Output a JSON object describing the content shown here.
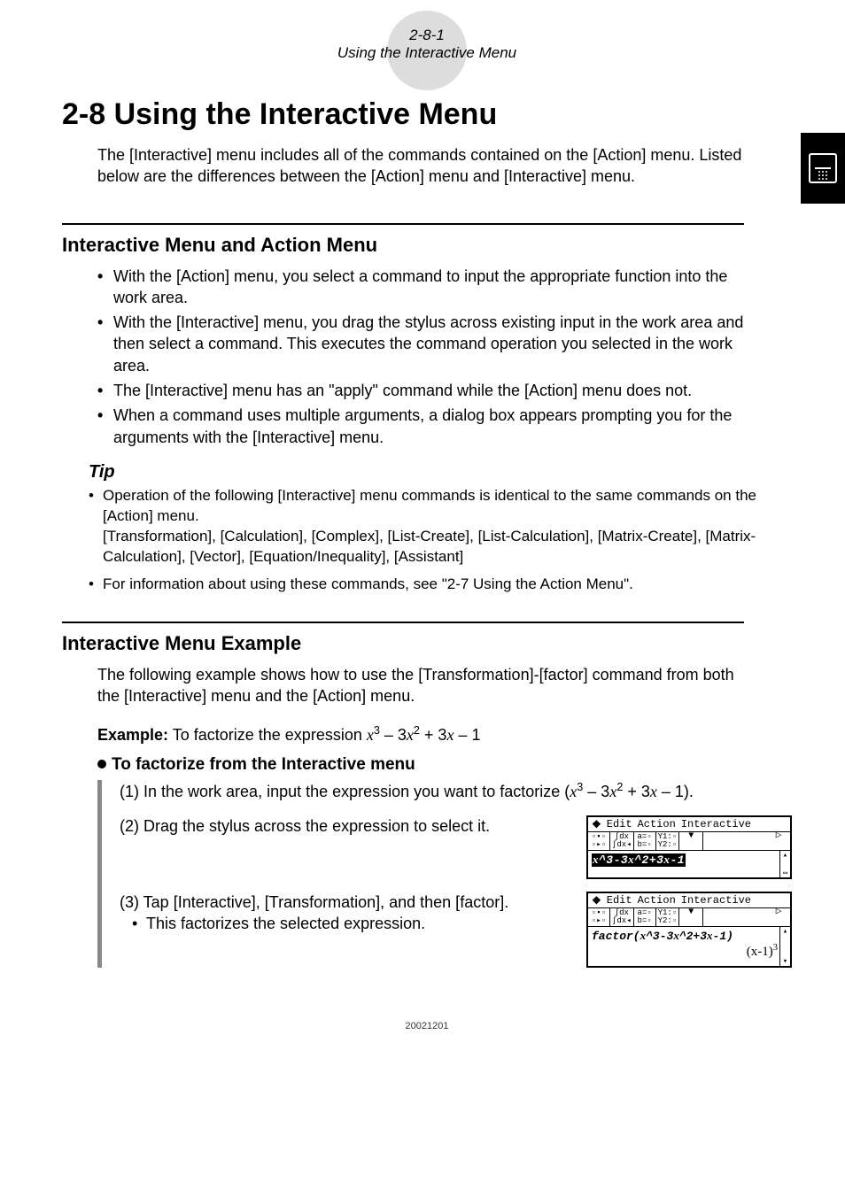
{
  "header": {
    "page_ref": "2-8-1",
    "section_title": "Using the Interactive Menu"
  },
  "title": "2-8 Using the Interactive Menu",
  "intro": "The [Interactive] menu includes all of the commands contained on the [Action] menu. Listed below are the differences between the [Action] menu and [Interactive] menu.",
  "section1": {
    "heading": "Interactive Menu and Action Menu",
    "bullets": [
      "With the [Action] menu, you select a command to input the appropriate function into the work area.",
      "With the [Interactive] menu, you drag the stylus across existing input in the work area and then select a command. This executes the command operation you selected in the work area.",
      "The [Interactive] menu has an \"apply\" command while the [Action] menu does not.",
      "When a command uses multiple arguments, a dialog box appears prompting you for the arguments with the [Interactive] menu."
    ],
    "tip_label": "Tip",
    "tips": [
      {
        "main": "Operation of the following [Interactive] menu commands is identical to the same commands on the [Action] menu.",
        "sub": "[Transformation], [Calculation], [Complex], [List-Create], [List-Calculation], [Matrix-Create], [Matrix-Calculation], [Vector], [Equation/Inequality], [Assistant]"
      },
      {
        "main": "For information about using these commands, see \"2-7 Using the Action Menu\"."
      }
    ]
  },
  "section2": {
    "heading": "Interactive Menu Example",
    "intro": "The following example shows how to use the [Transformation]-[factor] command from both the [Interactive] menu and the [Action] menu.",
    "example_label": "Example:",
    "example_text": "To factorize the expression ",
    "subhead": "To factorize from the Interactive menu",
    "steps": {
      "s1_prefix": "(1) In the work area, input the expression you want to factorize (",
      "s1_suffix": ").",
      "s2": "(2) Drag the stylus across the expression to select it.",
      "s3": "(3) Tap [Interactive], [Transformation], and then [factor].",
      "s3_sub": "This factorizes the selected expression."
    }
  },
  "calc": {
    "menu": {
      "m1": "Edit",
      "m2": "Action",
      "m3": "Interactive"
    },
    "screen1_expr": "x^3-3x^2+3x-1",
    "screen2_line1": "factor(x^3-3x^2+3x-1)",
    "screen2_resultBase": "(x-1)",
    "screen2_resultExp": "3"
  },
  "footer": "20021201"
}
